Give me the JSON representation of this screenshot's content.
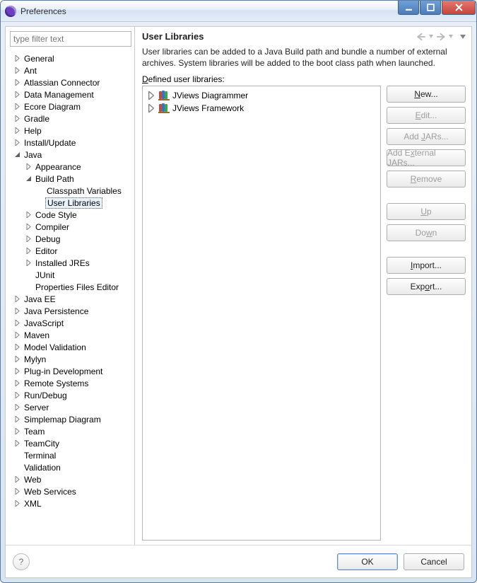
{
  "window": {
    "title": "Preferences"
  },
  "filter": {
    "placeholder": "type filter text"
  },
  "page": {
    "title": "User Libraries",
    "description": "User libraries can be added to a Java Build path and bundle a number of external archives. System libraries will be added to the boot class path when launched.",
    "defined_u": "D",
    "defined_rest": "efined user libraries:"
  },
  "footer": {
    "ok": "OK",
    "cancel": "Cancel"
  },
  "tree": [
    {
      "label": "General",
      "level": 0,
      "arrow": "closed"
    },
    {
      "label": "Ant",
      "level": 0,
      "arrow": "closed"
    },
    {
      "label": "Atlassian Connector",
      "level": 0,
      "arrow": "closed"
    },
    {
      "label": "Data Management",
      "level": 0,
      "arrow": "closed"
    },
    {
      "label": "Ecore Diagram",
      "level": 0,
      "arrow": "closed"
    },
    {
      "label": "Gradle",
      "level": 0,
      "arrow": "closed"
    },
    {
      "label": "Help",
      "level": 0,
      "arrow": "closed"
    },
    {
      "label": "Install/Update",
      "level": 0,
      "arrow": "closed"
    },
    {
      "label": "Java",
      "level": 0,
      "arrow": "open"
    },
    {
      "label": "Appearance",
      "level": 1,
      "arrow": "closed"
    },
    {
      "label": "Build Path",
      "level": 1,
      "arrow": "open"
    },
    {
      "label": "Classpath Variables",
      "level": 2,
      "arrow": "none"
    },
    {
      "label": "User Libraries",
      "level": 2,
      "arrow": "none",
      "selected": true
    },
    {
      "label": "Code Style",
      "level": 1,
      "arrow": "closed"
    },
    {
      "label": "Compiler",
      "level": 1,
      "arrow": "closed"
    },
    {
      "label": "Debug",
      "level": 1,
      "arrow": "closed"
    },
    {
      "label": "Editor",
      "level": 1,
      "arrow": "closed"
    },
    {
      "label": "Installed JREs",
      "level": 1,
      "arrow": "closed"
    },
    {
      "label": "JUnit",
      "level": 1,
      "arrow": "none"
    },
    {
      "label": "Properties Files Editor",
      "level": 1,
      "arrow": "none"
    },
    {
      "label": "Java EE",
      "level": 0,
      "arrow": "closed"
    },
    {
      "label": "Java Persistence",
      "level": 0,
      "arrow": "closed"
    },
    {
      "label": "JavaScript",
      "level": 0,
      "arrow": "closed"
    },
    {
      "label": "Maven",
      "level": 0,
      "arrow": "closed"
    },
    {
      "label": "Model Validation",
      "level": 0,
      "arrow": "closed"
    },
    {
      "label": "Mylyn",
      "level": 0,
      "arrow": "closed"
    },
    {
      "label": "Plug-in Development",
      "level": 0,
      "arrow": "closed"
    },
    {
      "label": "Remote Systems",
      "level": 0,
      "arrow": "closed"
    },
    {
      "label": "Run/Debug",
      "level": 0,
      "arrow": "closed"
    },
    {
      "label": "Server",
      "level": 0,
      "arrow": "closed"
    },
    {
      "label": "Simplemap Diagram",
      "level": 0,
      "arrow": "closed"
    },
    {
      "label": "Team",
      "level": 0,
      "arrow": "closed"
    },
    {
      "label": "TeamCity",
      "level": 0,
      "arrow": "closed"
    },
    {
      "label": "Terminal",
      "level": 0,
      "arrow": "none"
    },
    {
      "label": "Validation",
      "level": 0,
      "arrow": "none"
    },
    {
      "label": "Web",
      "level": 0,
      "arrow": "closed"
    },
    {
      "label": "Web Services",
      "level": 0,
      "arrow": "closed"
    },
    {
      "label": "XML",
      "level": 0,
      "arrow": "closed"
    }
  ],
  "libraries": [
    {
      "label": "JViews Diagrammer"
    },
    {
      "label": "JViews Framework"
    }
  ],
  "buttons": [
    {
      "key": "new",
      "pre": "",
      "u": "N",
      "post": "ew...",
      "enabled": true
    },
    {
      "key": "edit",
      "pre": "",
      "u": "E",
      "post": "dit...",
      "enabled": false
    },
    {
      "key": "add-jars",
      "pre": "Add ",
      "u": "J",
      "post": "ARs...",
      "enabled": false
    },
    {
      "key": "add-external-jars",
      "pre": "Add E",
      "u": "x",
      "post": "ternal JARs...",
      "enabled": false
    },
    {
      "key": "remove",
      "pre": "",
      "u": "R",
      "post": "emove",
      "enabled": false
    },
    {
      "key": "gap"
    },
    {
      "key": "up",
      "pre": "",
      "u": "U",
      "post": "p",
      "enabled": false
    },
    {
      "key": "down",
      "pre": "Do",
      "u": "w",
      "post": "n",
      "enabled": false
    },
    {
      "key": "gap"
    },
    {
      "key": "import",
      "pre": "",
      "u": "I",
      "post": "mport...",
      "enabled": true
    },
    {
      "key": "export",
      "pre": "Exp",
      "u": "o",
      "post": "rt...",
      "enabled": true
    }
  ]
}
